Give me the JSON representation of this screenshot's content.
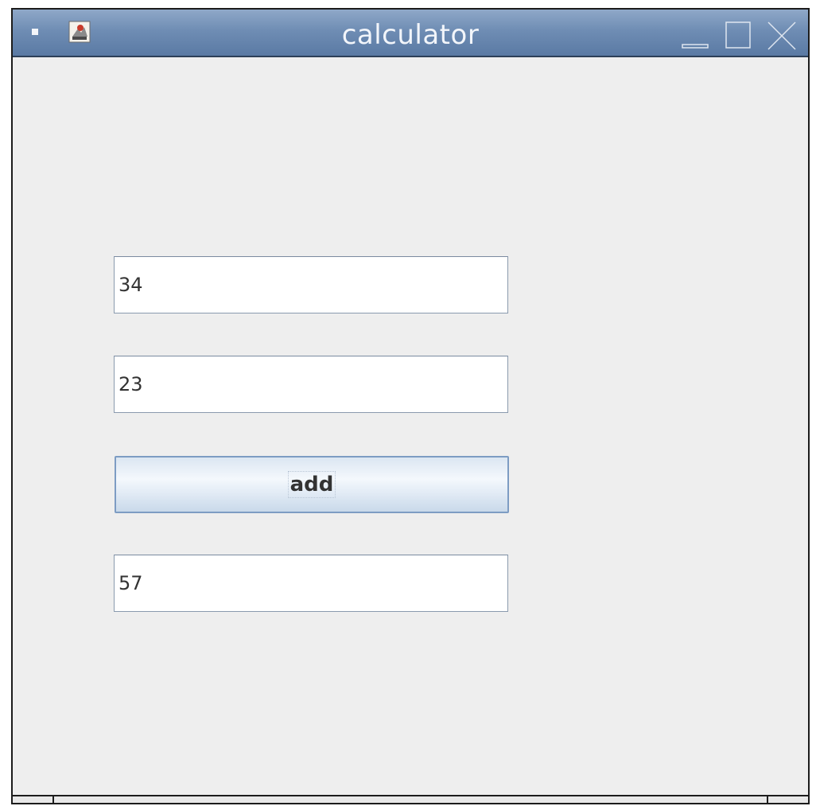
{
  "window": {
    "title": "calculator",
    "app_icon": "java-app-icon",
    "controls": {
      "minimize": "minimize-icon",
      "maximize": "maximize-icon",
      "close": "close-icon"
    }
  },
  "form": {
    "first_value": "34",
    "second_value": "23",
    "add_label": "add",
    "result_value": "57"
  },
  "colors": {
    "titlebar": "#6f8db4",
    "background": "#eeeeee",
    "button_border": "#7d9cc3"
  }
}
